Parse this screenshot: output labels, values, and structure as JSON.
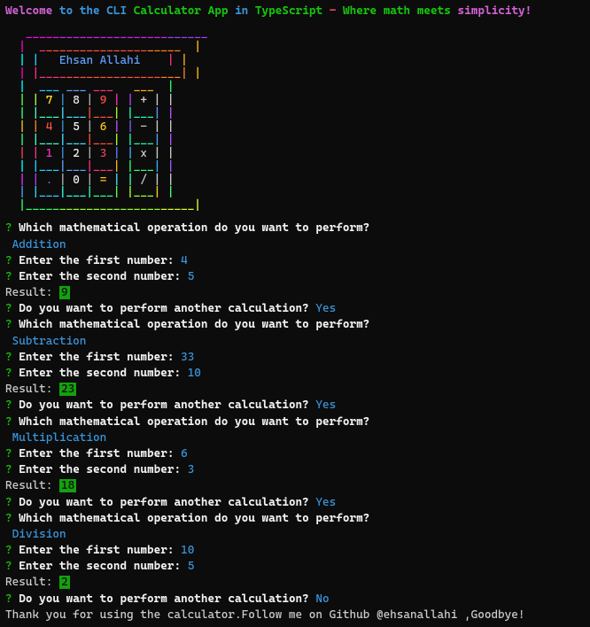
{
  "banner": {
    "w0": "Welcome",
    "w1": "to",
    "w2": "the",
    "w3": "CLI",
    "w4": "Calculator",
    "w5": "App",
    "w6": "in",
    "w7": "TypeScript",
    "w8": "-",
    "w9": "Where",
    "w10": "math",
    "w11": "meets",
    "w12": "simplicity!"
  },
  "ascii": {
    "author": "Ehsan Allahi",
    "row1": {
      "k1": "7",
      "k2": "8",
      "k3": "9",
      "op": "+"
    },
    "row2": {
      "k1": "4",
      "k2": "5",
      "k3": "6",
      "op": "-"
    },
    "row3": {
      "k1": "1",
      "k2": "2",
      "k3": "3",
      "op": "x"
    },
    "row4": {
      "k1": ".",
      "k2": "0",
      "k3": "=",
      "op": "/"
    }
  },
  "prompts": {
    "which_op": "Which mathematical operation do you want to perform?",
    "enter_first": "Enter the first number:",
    "enter_second": "Enter the second number:",
    "result": "Result:",
    "another": "Do you want to perform another calculation?",
    "yes": "Yes",
    "no": "No"
  },
  "ops": {
    "addition": "Addition",
    "subtraction": "Subtraction",
    "multiplication": "Multiplication",
    "division": "Division"
  },
  "values": {
    "add_a": "4",
    "add_b": "5",
    "add_r": "9",
    "sub_a": "33",
    "sub_b": "10",
    "sub_r": "23",
    "mul_a": "6",
    "mul_b": "3",
    "mul_r": "18",
    "div_a": "10",
    "div_b": "5",
    "div_r": "2"
  },
  "goodbye": "Thank you for using the calculator.Follow me on Github @ehsanallahi ,Goodbye!"
}
